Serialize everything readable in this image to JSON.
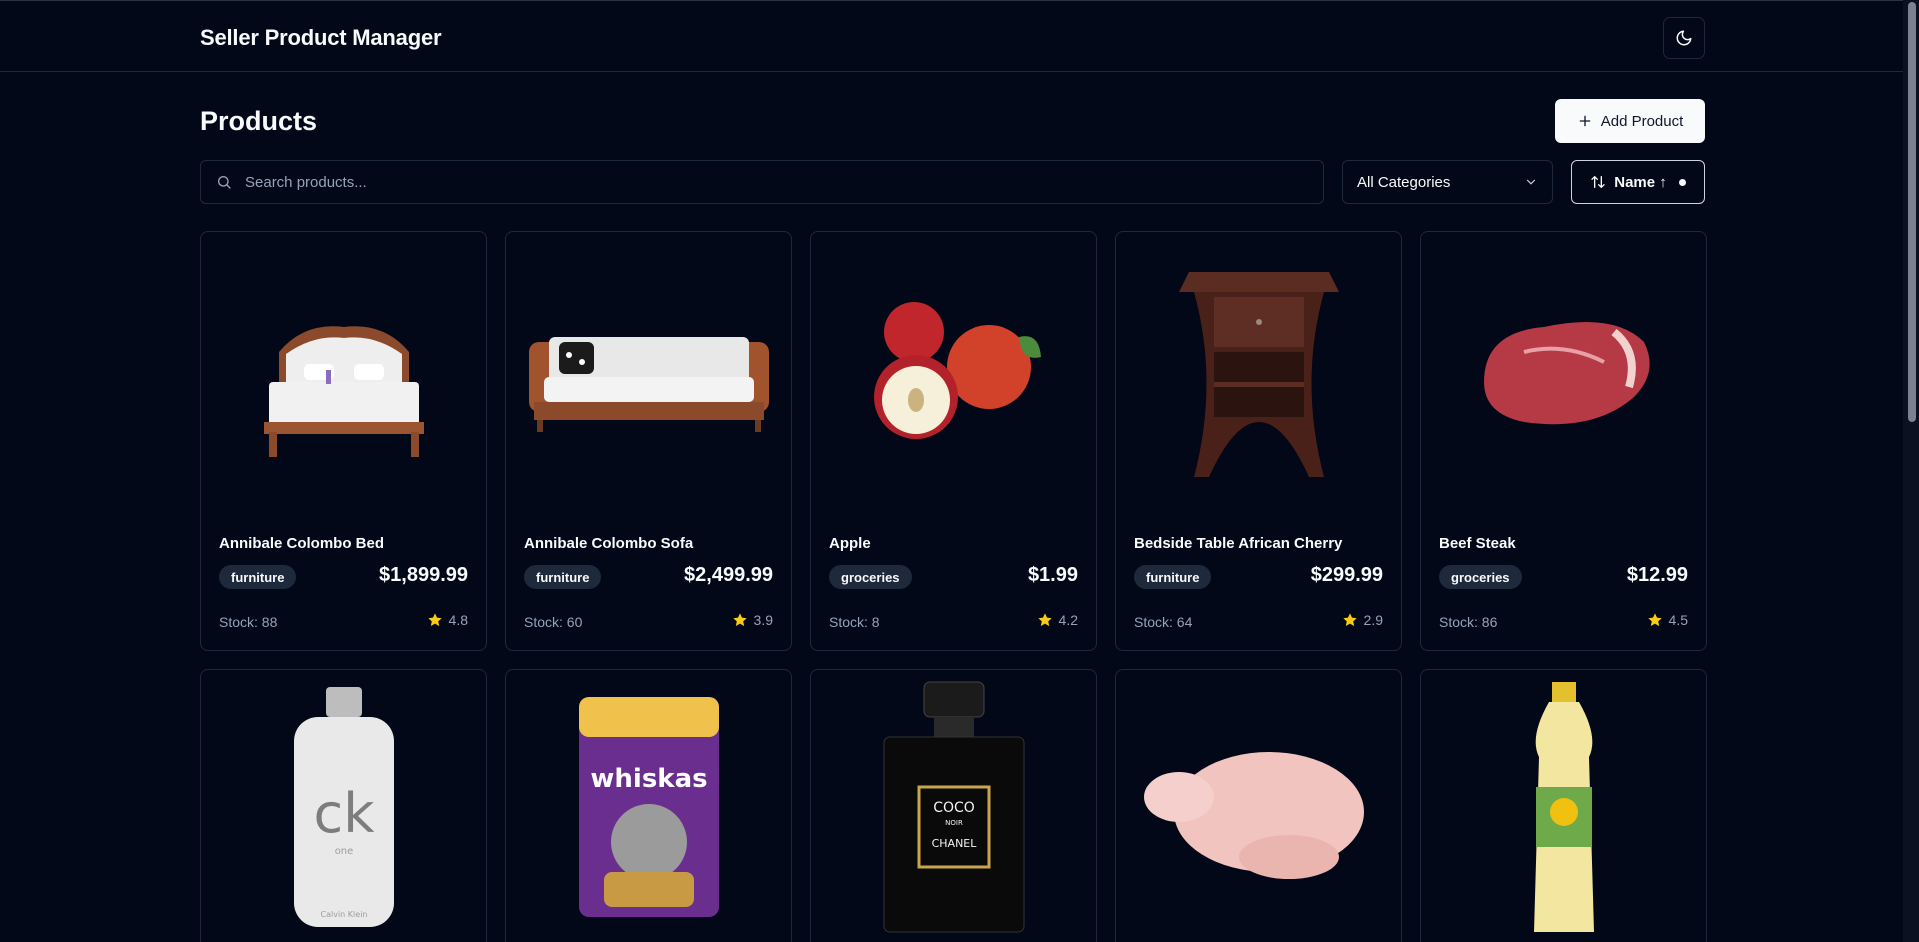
{
  "header": {
    "app_title": "Seller Product Manager",
    "theme_toggle_icon": "moon-icon"
  },
  "page": {
    "title": "Products",
    "add_button_label": "Add Product"
  },
  "filters": {
    "search_placeholder": "Search products...",
    "category_selected": "All Categories",
    "sort_label": "Name ↑"
  },
  "colors": {
    "background": "#020817",
    "border": "#1e293b",
    "star": "#facc15",
    "muted": "#94a3b8"
  },
  "products": [
    {
      "name": "Annibale Colombo Bed",
      "category": "furniture",
      "price": "$1,899.99",
      "stock": "Stock: 88",
      "rating": "4.8",
      "image": "bed"
    },
    {
      "name": "Annibale Colombo Sofa",
      "category": "furniture",
      "price": "$2,499.99",
      "stock": "Stock: 60",
      "rating": "3.9",
      "image": "sofa"
    },
    {
      "name": "Apple",
      "category": "groceries",
      "price": "$1.99",
      "stock": "Stock: 8",
      "rating": "4.2",
      "image": "apple"
    },
    {
      "name": "Bedside Table African Cherry",
      "category": "furniture",
      "price": "$299.99",
      "stock": "Stock: 64",
      "rating": "2.9",
      "image": "nightstand"
    },
    {
      "name": "Beef Steak",
      "category": "groceries",
      "price": "$12.99",
      "stock": "Stock: 86",
      "rating": "4.5",
      "image": "steak"
    }
  ],
  "products_row2": [
    {
      "image": "perfume-bottle",
      "label": "ck",
      "sublabel": "one",
      "brand": "Calvin Klein"
    },
    {
      "image": "cat-food-pouch",
      "label": "whiskas"
    },
    {
      "image": "perfume-black",
      "label": "COCO",
      "sublabel": "NOIR",
      "brand": "CHANEL"
    },
    {
      "image": "chicken"
    },
    {
      "image": "oil-bottle"
    }
  ]
}
